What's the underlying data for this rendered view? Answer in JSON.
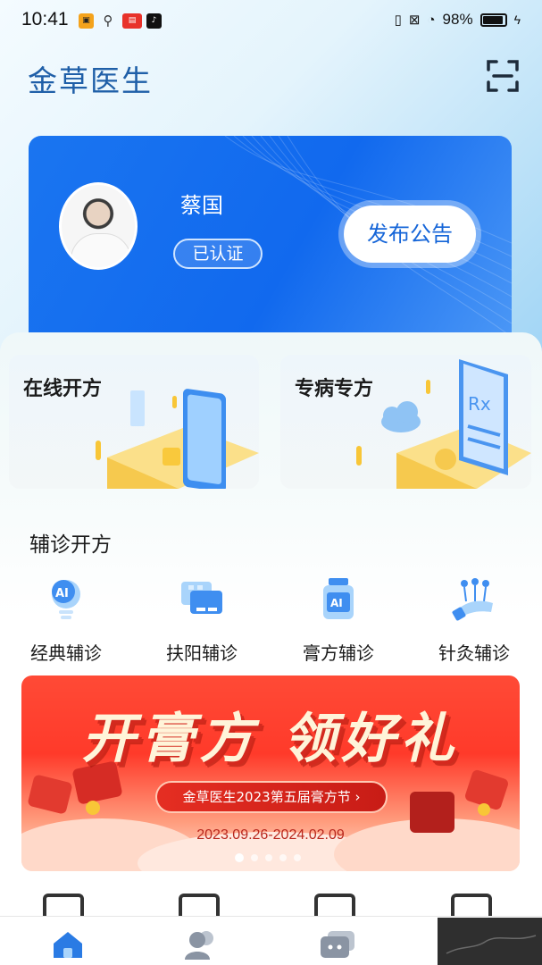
{
  "status_bar": {
    "time": "10:41",
    "battery": "98%",
    "notification_icons": [
      "cube-icon",
      "usb-icon",
      "news-icon",
      "tiktok-icon"
    ]
  },
  "app": {
    "title": "金草医生"
  },
  "doctor": {
    "name": "蔡国",
    "verified_label": "已认证",
    "publish_button": "发布公告"
  },
  "features": [
    {
      "label": "在线开方",
      "icon": "tablet-icon"
    },
    {
      "label": "专病专方",
      "icon": "prescription-icon"
    }
  ],
  "assist": {
    "section_title": "辅诊开方",
    "tools": [
      {
        "label": "经典辅诊",
        "icon": "ai-bulb-icon"
      },
      {
        "label": "扶阳辅诊",
        "icon": "chat-icon"
      },
      {
        "label": "膏方辅诊",
        "icon": "ai-jar-icon"
      },
      {
        "label": "针灸辅诊",
        "icon": "acupuncture-icon"
      }
    ]
  },
  "banner": {
    "headline": "开膏方 领好礼",
    "subtitle": "金草医生2023第五届膏方节 ›",
    "dates": "2023.09.26-2024.02.09",
    "slide_count": 5,
    "active_slide": 1
  },
  "tab_bar": {
    "tabs": [
      {
        "icon": "home-icon",
        "active": true
      },
      {
        "icon": "patients-icon",
        "active": false
      },
      {
        "icon": "messages-icon",
        "active": false
      }
    ]
  },
  "colors": {
    "brand_blue": "#1169ee",
    "title_blue": "#1f5fa8",
    "banner_red": "#ff3a2a"
  }
}
